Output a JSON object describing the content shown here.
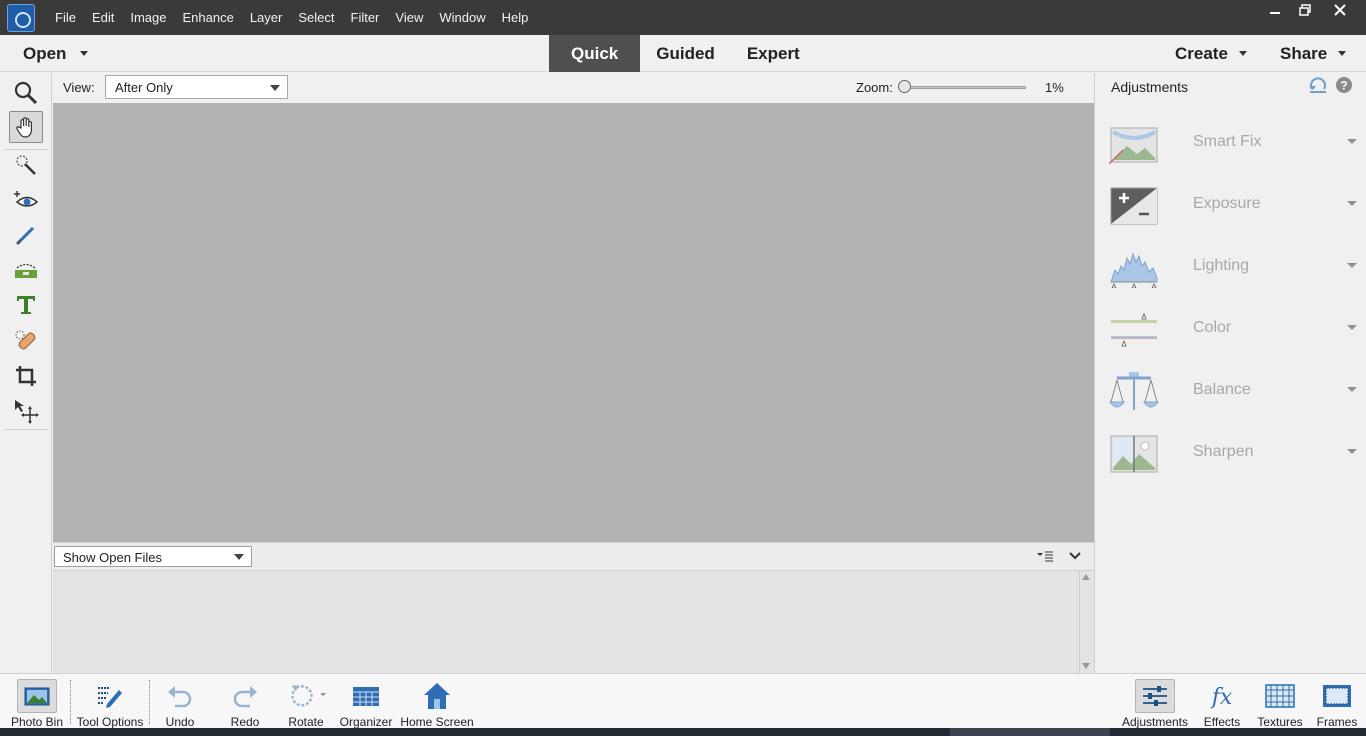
{
  "menu": {
    "items": [
      "File",
      "Edit",
      "Image",
      "Enhance",
      "Layer",
      "Select",
      "Filter",
      "View",
      "Window",
      "Help"
    ]
  },
  "window_controls": {
    "minimize": "minimize-icon",
    "restore": "restore-icon",
    "close": "close-icon"
  },
  "modebar": {
    "open_label": "Open",
    "tabs": [
      {
        "label": "Quick",
        "active": true
      },
      {
        "label": "Guided",
        "active": false
      },
      {
        "label": "Expert",
        "active": false
      }
    ],
    "create_label": "Create",
    "share_label": "Share"
  },
  "tools": [
    "zoom-tool",
    "hand-tool",
    "quick-selection-tool",
    "red-eye-tool",
    "whiten-teeth-tool",
    "straighten-tool",
    "type-tool",
    "spot-healing-tool",
    "crop-tool",
    "move-tool"
  ],
  "options": {
    "view_label": "View:",
    "view_value": "After Only",
    "zoom_label": "Zoom:",
    "zoom_value": "1%",
    "zoom_fraction": 0.0
  },
  "photo_bin": {
    "show_label": "Show Open Files"
  },
  "adjustments": {
    "title": "Adjustments",
    "items": [
      {
        "label": "Smart Fix"
      },
      {
        "label": "Exposure"
      },
      {
        "label": "Lighting"
      },
      {
        "label": "Color"
      },
      {
        "label": "Balance"
      },
      {
        "label": "Sharpen"
      }
    ]
  },
  "taskbar": {
    "left": [
      {
        "label": "Photo Bin"
      },
      {
        "label": "Tool Options"
      },
      {
        "label": "Undo"
      },
      {
        "label": "Redo"
      },
      {
        "label": "Rotate"
      },
      {
        "label": "Organizer"
      },
      {
        "label": "Home Screen"
      }
    ],
    "right": [
      {
        "label": "Adjustments"
      },
      {
        "label": "Effects"
      },
      {
        "label": "Textures"
      },
      {
        "label": "Frames"
      }
    ]
  },
  "colors": {
    "titlebar": "#3a3a3a",
    "canvas": "#b3b3b3",
    "active_tab": "#4f4f4f",
    "accent_blue": "#2f6db5"
  }
}
